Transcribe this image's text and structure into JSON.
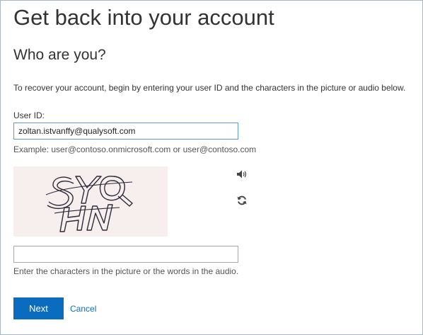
{
  "page": {
    "title": "Get back into your account",
    "subtitle": "Who are you?",
    "instructions": "To recover your account, begin by entering your user ID and the characters in the picture or audio below."
  },
  "user_id": {
    "label": "User ID:",
    "value": "zoltan.istvanffy@qualysoft.com",
    "example": "Example: user@contoso.onmicrosoft.com or user@contoso.com"
  },
  "captcha": {
    "image_text": "SYQ HN",
    "audio_icon": "speaker-icon",
    "refresh_icon": "refresh-icon",
    "input_value": "",
    "hint": "Enter the characters in the picture or the words in the audio."
  },
  "actions": {
    "next_label": "Next",
    "cancel_label": "Cancel"
  },
  "colors": {
    "accent": "#0b6cbf",
    "input_focus_border": "#5b9bd5",
    "captcha_background": "#f7eeee"
  }
}
